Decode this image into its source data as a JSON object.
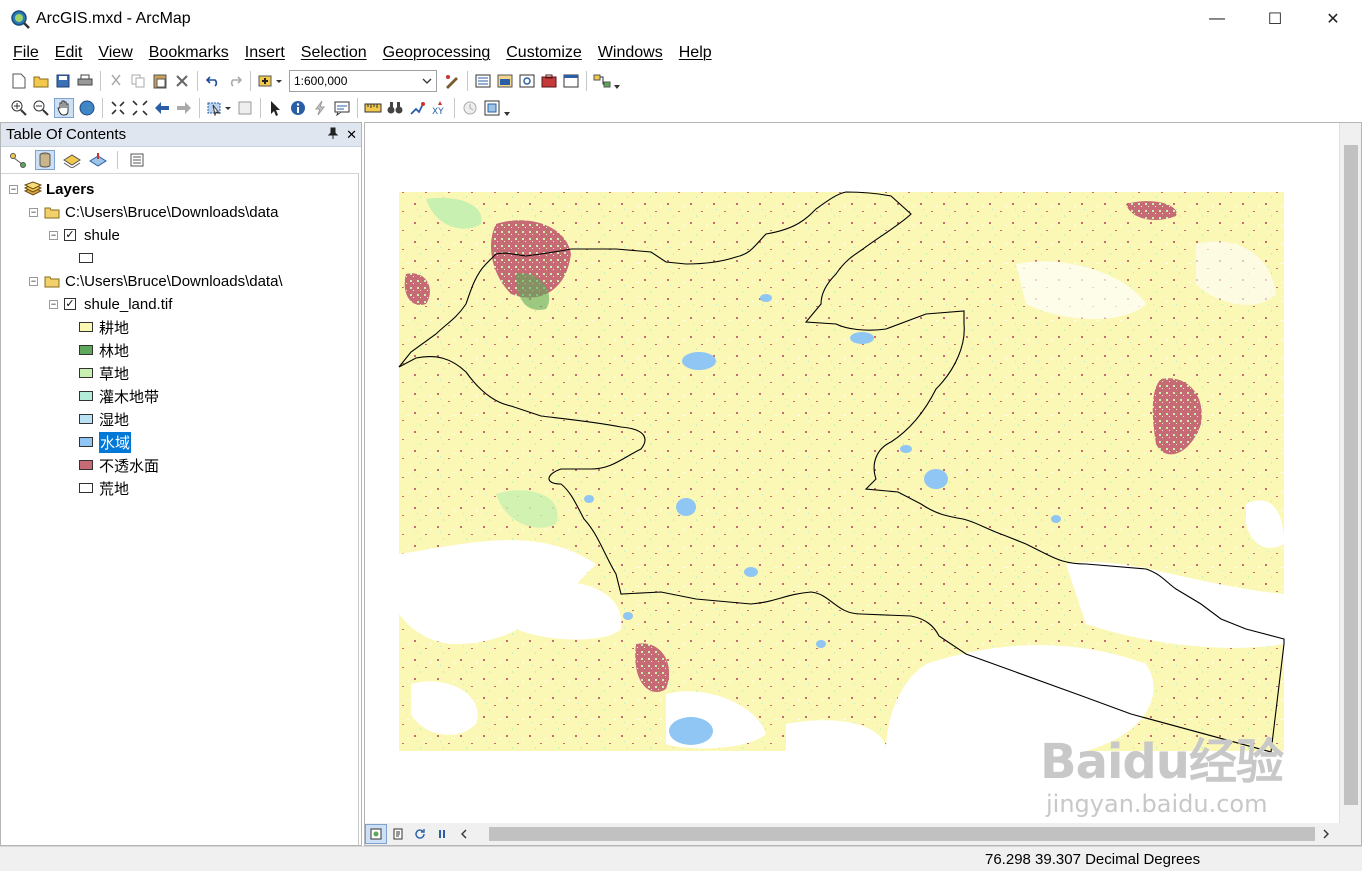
{
  "window": {
    "title": "ArcGIS.mxd - ArcMap",
    "minimize": "—",
    "maximize": "☐",
    "close": "✕"
  },
  "menu": [
    "File",
    "Edit",
    "View",
    "Bookmarks",
    "Insert",
    "Selection",
    "Geoprocessing",
    "Customize",
    "Windows",
    "Help"
  ],
  "toolbar": {
    "scale": "1:600,000"
  },
  "toc": {
    "title": "Table Of Contents",
    "pin": "ᵖ",
    "close": "✕",
    "root": "Layers",
    "groups": [
      {
        "path": "C:\\Users\\Bruce\\Downloads\\data",
        "layer": "shule",
        "checked": true
      },
      {
        "path": "C:\\Users\\Bruce\\Downloads\\data\\",
        "layer": "shule_land.tif",
        "checked": true,
        "classes": [
          {
            "label": "耕地",
            "color": "#fbf8b6"
          },
          {
            "label": "林地",
            "color": "#5ea85a"
          },
          {
            "label": "草地",
            "color": "#c8f0b0"
          },
          {
            "label": "灌木地带",
            "color": "#b3ecd8"
          },
          {
            "label": "湿地",
            "color": "#b9e3f5"
          },
          {
            "label": "水域",
            "color": "#8fc6f3"
          },
          {
            "label": "不透水面",
            "color": "#c66b76"
          },
          {
            "label": "荒地",
            "color": "#ffffff"
          }
        ]
      }
    ]
  },
  "status": {
    "coordinates": "76.298  39.307 Decimal Degrees"
  },
  "watermark": {
    "brand": "Baidu经验",
    "url": "jingyan.baidu.com"
  }
}
